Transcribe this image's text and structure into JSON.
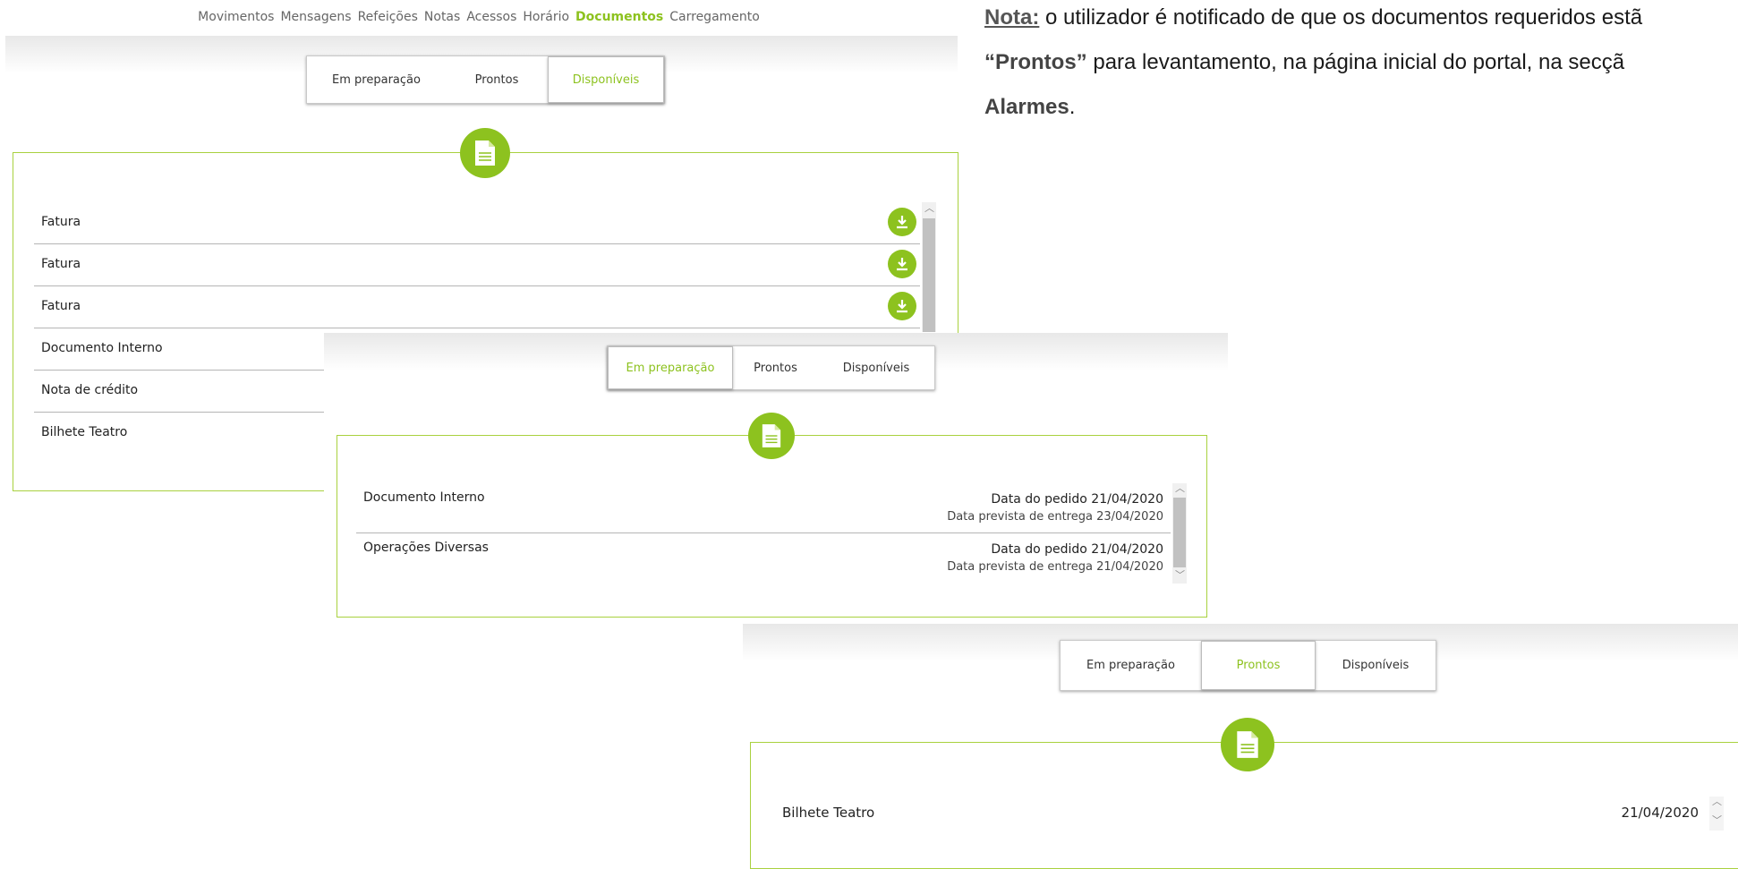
{
  "nav": {
    "items": [
      "Movimentos",
      "Mensagens",
      "Refeições",
      "Notas",
      "Acessos",
      "Horário",
      "Documentos",
      "Carregamento"
    ],
    "active": "Documentos"
  },
  "tabs": {
    "em_preparacao": "Em preparação",
    "prontos": "Prontos",
    "disponiveis": "Disponíveis"
  },
  "panel_disponiveis": {
    "rows": [
      "Fatura",
      "Fatura",
      "Fatura",
      "Documento Interno",
      "Nota de crédito",
      "Bilhete Teatro"
    ]
  },
  "panel_preparacao": {
    "rows": [
      {
        "label": "Documento Interno",
        "date1": "Data do pedido 21/04/2020",
        "date2": "Data prevista de entrega 23/04/2020"
      },
      {
        "label": "Operações Diversas",
        "date1": "Data do pedido 21/04/2020",
        "date2": "Data prevista de entrega 21/04/2020"
      }
    ]
  },
  "panel_prontos": {
    "rows": [
      {
        "label": "Bilhete Teatro",
        "date": "21/04/2020"
      }
    ]
  },
  "note": {
    "label": "Nota:",
    "line1": " o utilizador é notificado de que os documentos requeridos estã",
    "prontos_word": "“Prontos”",
    "line2": " para levantamento, na página inicial do portal, na secçã",
    "alarmes": "Alarmes",
    "period": "."
  },
  "colors": {
    "accent": "#8dc21f",
    "panel_border": "#a9d13f"
  }
}
